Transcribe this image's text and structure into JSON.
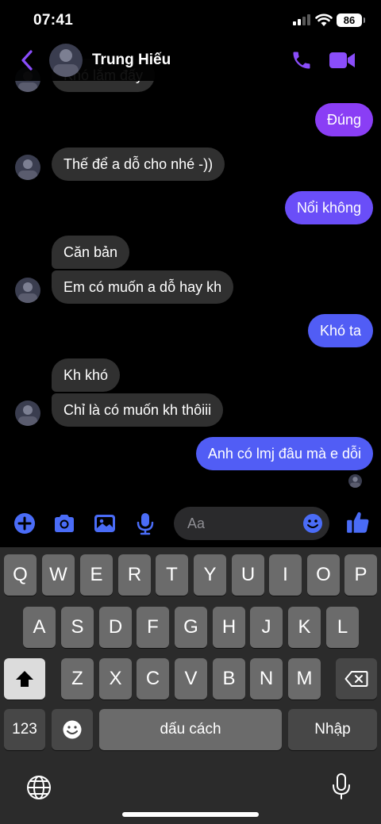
{
  "status_bar": {
    "time": "07:41",
    "battery": "86"
  },
  "header": {
    "contact_name": "Trung Hiếu"
  },
  "messages": [
    {
      "id": "m0",
      "side": "in",
      "text": "Khó lắm đấy"
    },
    {
      "id": "m1",
      "side": "out",
      "text": "Đúng"
    },
    {
      "id": "m2",
      "side": "in",
      "text": "Thế để a dỗ cho nhé -))"
    },
    {
      "id": "m3",
      "side": "out",
      "text": "Nổi không"
    },
    {
      "id": "m4",
      "side": "in",
      "text": "Căn bản"
    },
    {
      "id": "m5",
      "side": "in",
      "text": "Em có muốn a dỗ hay kh"
    },
    {
      "id": "m6",
      "side": "out",
      "text": "Khó ta"
    },
    {
      "id": "m7",
      "side": "in",
      "text": "Kh khó"
    },
    {
      "id": "m8",
      "side": "in",
      "text": "Chỉ là có muốn kh thôiii"
    },
    {
      "id": "m9",
      "side": "out",
      "text": "Anh có lmj đâu mà e dỗi"
    }
  ],
  "composer": {
    "placeholder": "Aa",
    "icons": [
      "plus-circle-icon",
      "camera-icon",
      "image-icon",
      "microphone-icon",
      "smiley-icon",
      "thumbs-up-icon"
    ]
  },
  "keyboard": {
    "row1": [
      "Q",
      "W",
      "E",
      "R",
      "T",
      "Y",
      "U",
      "I",
      "O",
      "P"
    ],
    "row2": [
      "A",
      "S",
      "D",
      "F",
      "G",
      "H",
      "J",
      "K",
      "L"
    ],
    "row3": [
      "Z",
      "X",
      "C",
      "V",
      "B",
      "N",
      "M"
    ],
    "num_key": "123",
    "space_key": "dấu cách",
    "return_key": "Nhập"
  },
  "colors": {
    "outgoing_violet": "#8a3ef5",
    "outgoing_blue": "#515df5",
    "incoming": "#303030",
    "accent": "#8a4dfa"
  }
}
